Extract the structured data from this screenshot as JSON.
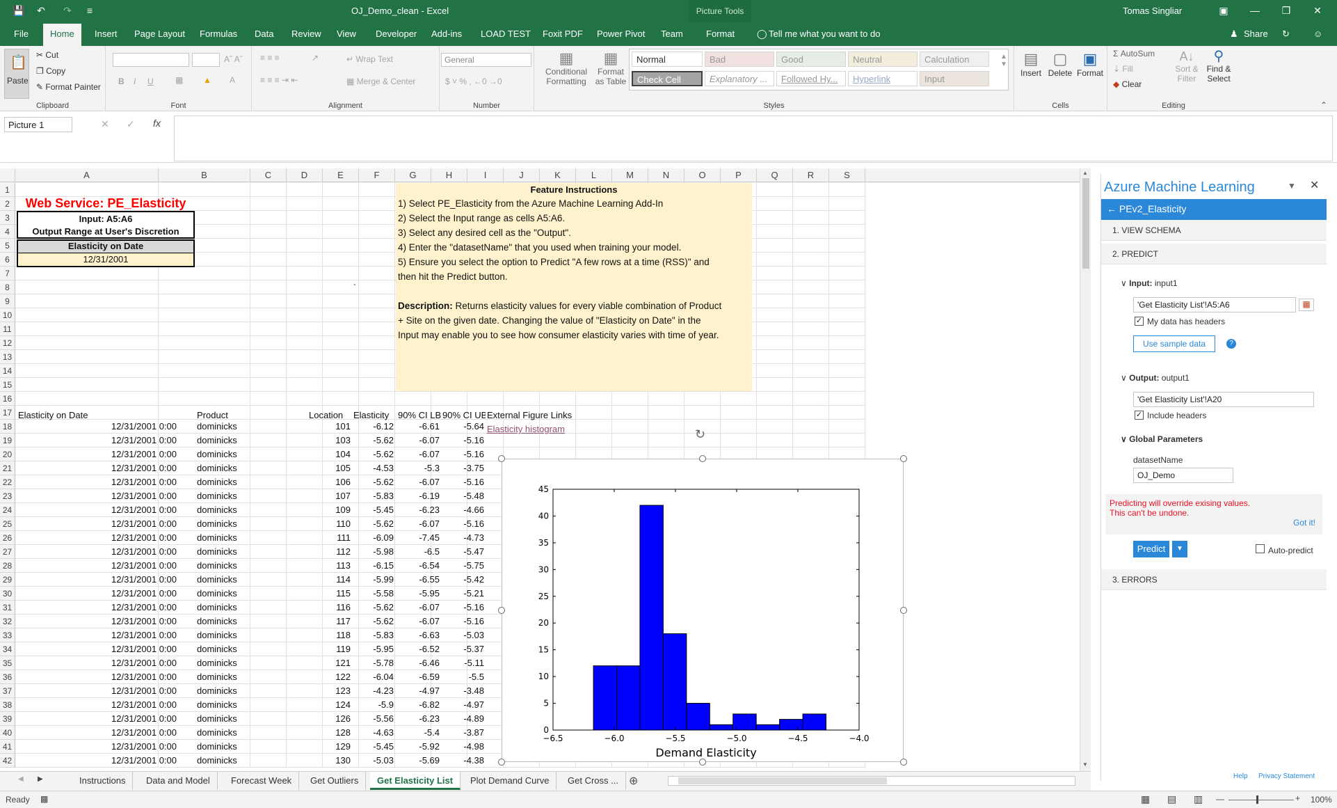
{
  "window": {
    "title": "OJ_Demo_clean  -  Excel",
    "context_tab": "Picture Tools",
    "user": "Tomas Singliar"
  },
  "tabs": [
    "File",
    "Home",
    "Insert",
    "Page Layout",
    "Formulas",
    "Data",
    "Review",
    "View",
    "Developer",
    "Add-ins",
    "LOAD TEST",
    "Foxit PDF",
    "Power Pivot",
    "Team",
    "Format"
  ],
  "active_tab": "Home",
  "tell_me": "Tell me what you want to do",
  "share": "Share",
  "ribbon": {
    "clipboard": {
      "label": "Clipboard",
      "paste": "Paste",
      "cut": "Cut",
      "copy": "Copy",
      "format_painter": "Format Painter"
    },
    "font": {
      "label": "Font",
      "bold": "B",
      "italic": "I",
      "underline": "U"
    },
    "alignment": {
      "label": "Alignment",
      "wrap": "Wrap Text",
      "merge": "Merge & Center"
    },
    "number": {
      "label": "Number",
      "format": "General"
    },
    "styles": {
      "label": "Styles",
      "conditional": "Conditional Formatting",
      "format_table": "Format as Table",
      "normal": "Normal",
      "bad": "Bad",
      "good": "Good",
      "neutral": "Neutral",
      "calculation": "Calculation",
      "check_cell": "Check Cell",
      "explanatory": "Explanatory ...",
      "followed": "Followed Hy...",
      "hyperlink": "Hyperlink",
      "input": "Input"
    },
    "cells": {
      "label": "Cells",
      "insert": "Insert",
      "delete": "Delete",
      "format": "Format"
    },
    "editing": {
      "label": "Editing",
      "autosum": "AutoSum",
      "fill": "Fill",
      "clear": "Clear",
      "sort": "Sort & Filter",
      "find": "Find & Select"
    }
  },
  "formula_bar": {
    "name_box": "Picture 1",
    "fx": "fx",
    "content": ""
  },
  "columns": [
    "A",
    "B",
    "C",
    "D",
    "E",
    "F",
    "G",
    "H",
    "I",
    "J",
    "K",
    "L",
    "M",
    "N",
    "O",
    "P",
    "Q",
    "R",
    "S"
  ],
  "rows": [
    1,
    2,
    3,
    4,
    5,
    6,
    7,
    8,
    9,
    10,
    11,
    12,
    13,
    14,
    15,
    16,
    17,
    18,
    19,
    20,
    21,
    22,
    23,
    24,
    25,
    26,
    27,
    28,
    29,
    30,
    31,
    32,
    33,
    34,
    35,
    36,
    37,
    38,
    39,
    40,
    41,
    42
  ],
  "sheet": {
    "ws_title": "Web Service: PE_Elasticity",
    "input_label": "Input: A5:A6",
    "output_label": "Output Range at User's Discretion",
    "elasticity_header": "Elasticity on Date",
    "elasticity_date": "12/31/2001",
    "feature_title": "Feature Instructions",
    "stray_char": "`",
    "instructions": [
      "1) Select PE_Elasticity from the Azure Machine Learning Add-In",
      "2) Select the Input range as cells A5:A6.",
      "3) Select any desired cell as the \"Output\".",
      "4) Enter the \"datasetName\" that you used when training your model.",
      "5) Ensure you select the option to Predict \"A few rows at a time (RSS)\" and",
      "then hit the Predict button."
    ],
    "description_label": "Description:",
    "description": [
      " Returns elasticity values for every viable combination of Product",
      "+ Site on the given date. Changing the value of \"Elasticity on Date\" in the",
      "Input may enable you to see how consumer elasticity varies with time of year."
    ],
    "table_headers": [
      "Elasticity on Date",
      "Product",
      "Location",
      "Elasticity",
      "90% CI LB",
      "90% CI UB",
      "External Figure Links"
    ],
    "link": "Elasticity histogram",
    "table_rows": [
      [
        "12/31/2001 0:00",
        "dominicks",
        "101",
        "-6.12",
        "-6.61",
        "-5.64"
      ],
      [
        "12/31/2001 0:00",
        "dominicks",
        "103",
        "-5.62",
        "-6.07",
        "-5.16"
      ],
      [
        "12/31/2001 0:00",
        "dominicks",
        "104",
        "-5.62",
        "-6.07",
        "-5.16"
      ],
      [
        "12/31/2001 0:00",
        "dominicks",
        "105",
        "-4.53",
        "-5.3",
        "-3.75"
      ],
      [
        "12/31/2001 0:00",
        "dominicks",
        "106",
        "-5.62",
        "-6.07",
        "-5.16"
      ],
      [
        "12/31/2001 0:00",
        "dominicks",
        "107",
        "-5.83",
        "-6.19",
        "-5.48"
      ],
      [
        "12/31/2001 0:00",
        "dominicks",
        "109",
        "-5.45",
        "-6.23",
        "-4.66"
      ],
      [
        "12/31/2001 0:00",
        "dominicks",
        "110",
        "-5.62",
        "-6.07",
        "-5.16"
      ],
      [
        "12/31/2001 0:00",
        "dominicks",
        "111",
        "-6.09",
        "-7.45",
        "-4.73"
      ],
      [
        "12/31/2001 0:00",
        "dominicks",
        "112",
        "-5.98",
        "-6.5",
        "-5.47"
      ],
      [
        "12/31/2001 0:00",
        "dominicks",
        "113",
        "-6.15",
        "-6.54",
        "-5.75"
      ],
      [
        "12/31/2001 0:00",
        "dominicks",
        "114",
        "-5.99",
        "-6.55",
        "-5.42"
      ],
      [
        "12/31/2001 0:00",
        "dominicks",
        "115",
        "-5.58",
        "-5.95",
        "-5.21"
      ],
      [
        "12/31/2001 0:00",
        "dominicks",
        "116",
        "-5.62",
        "-6.07",
        "-5.16"
      ],
      [
        "12/31/2001 0:00",
        "dominicks",
        "117",
        "-5.62",
        "-6.07",
        "-5.16"
      ],
      [
        "12/31/2001 0:00",
        "dominicks",
        "118",
        "-5.83",
        "-6.63",
        "-5.03"
      ],
      [
        "12/31/2001 0:00",
        "dominicks",
        "119",
        "-5.95",
        "-6.52",
        "-5.37"
      ],
      [
        "12/31/2001 0:00",
        "dominicks",
        "121",
        "-5.78",
        "-6.46",
        "-5.11"
      ],
      [
        "12/31/2001 0:00",
        "dominicks",
        "122",
        "-6.04",
        "-6.59",
        "-5.5"
      ],
      [
        "12/31/2001 0:00",
        "dominicks",
        "123",
        "-4.23",
        "-4.97",
        "-3.48"
      ],
      [
        "12/31/2001 0:00",
        "dominicks",
        "124",
        "-5.9",
        "-6.82",
        "-4.97"
      ],
      [
        "12/31/2001 0:00",
        "dominicks",
        "126",
        "-5.56",
        "-6.23",
        "-4.89"
      ],
      [
        "12/31/2001 0:00",
        "dominicks",
        "128",
        "-4.63",
        "-5.4",
        "-3.87"
      ],
      [
        "12/31/2001 0:00",
        "dominicks",
        "129",
        "-5.45",
        "-5.92",
        "-4.98"
      ],
      [
        "12/31/2001 0:00",
        "dominicks",
        "130",
        "-5.03",
        "-5.69",
        "-4.38"
      ]
    ]
  },
  "chart_data": {
    "type": "bar",
    "title": "",
    "xlabel": "Demand Elasticity",
    "ylabel": "",
    "bins": [
      [
        -6.17,
        -5.98
      ],
      [
        -5.98,
        -5.79
      ],
      [
        -5.79,
        -5.6
      ],
      [
        -5.6,
        -5.41
      ],
      [
        -5.41,
        -5.22
      ],
      [
        -5.22,
        -5.03
      ],
      [
        -5.03,
        -4.84
      ],
      [
        -4.84,
        -4.65
      ],
      [
        -4.65,
        -4.46
      ],
      [
        -4.46,
        -4.27
      ]
    ],
    "values": [
      12,
      12,
      42,
      18,
      5,
      1,
      3,
      1,
      2,
      3
    ],
    "xlim": [
      -6.5,
      -4.0
    ],
    "ylim": [
      0,
      45
    ],
    "xticks": [
      "−6.5",
      "−6.0",
      "−5.5",
      "−5.0",
      "−4.5",
      "−4.0"
    ],
    "xtick_values": [
      -6.5,
      -6.0,
      -5.5,
      -5.0,
      -4.5,
      -4.0
    ],
    "yticks": [
      0,
      5,
      10,
      15,
      20,
      25,
      30,
      35,
      40,
      45
    ],
    "bar_color": "#0000ff",
    "grid": false
  },
  "sheet_tabs": [
    "Instructions",
    "Data and Model",
    "Forecast Week",
    "Get Outliers",
    "Get Elasticity List",
    "Plot Demand Curve",
    "Get Cross ..."
  ],
  "active_sheet": "Get Elasticity List",
  "status": {
    "ready": "Ready",
    "zoom": "100%"
  },
  "pane": {
    "title": "Azure Machine Learning",
    "service": "PEv2_Elasticity",
    "view_schema": "1. VIEW SCHEMA",
    "predict": "2. PREDICT",
    "input_label": "Input:",
    "input_name": "input1",
    "input_range": "'Get Elasticity List'!A5:A6",
    "has_headers": "My data has headers",
    "sample": "Use sample data",
    "help_q": "?",
    "output_label": "Output:",
    "output_name": "output1",
    "output_range": "'Get Elasticity List'!A20",
    "include_headers": "Include headers",
    "global_params": "Global Parameters",
    "dataset_label": "datasetName",
    "dataset_value": "OJ_Demo",
    "warning1": "Predicting will override exising values.",
    "warning2": "This can't be undone.",
    "gotit": "Got it!",
    "predict_btn": "Predict",
    "auto_predict": "Auto-predict",
    "errors": "3. ERRORS",
    "help": "Help",
    "privacy": "Privacy Statement"
  },
  "colors": {
    "excel_green": "#217346",
    "instr_bg": "#fff2cc",
    "azure_blue": "#2b88d8",
    "warning_red": "#e81123",
    "title_red": "#ff0000"
  }
}
